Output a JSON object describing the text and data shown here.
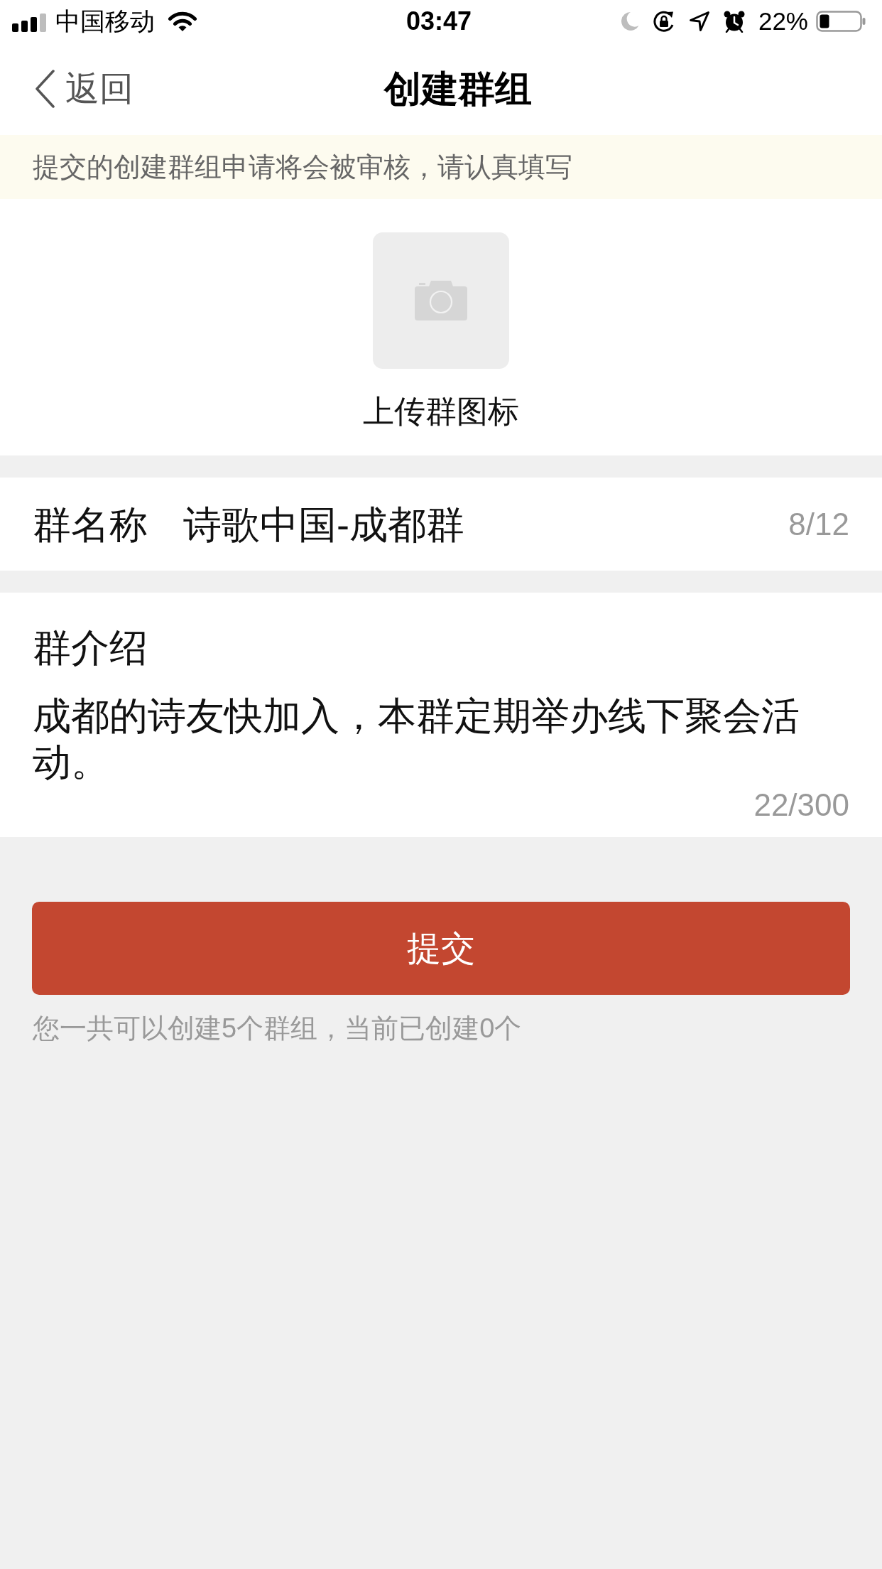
{
  "status_bar": {
    "carrier": "中国移动",
    "time": "03:47",
    "battery": "22%"
  },
  "nav_bar": {
    "back": "返回",
    "title": "创建群组"
  },
  "notice": "提交的创建群组申请将会被审核，请认真填写",
  "group_icon": {
    "label": "上传群图标"
  },
  "group_name": {
    "label": "群名称",
    "value": "诗歌中国-成都群",
    "counter": "8/12"
  },
  "group_intro": {
    "label": "群介绍",
    "value": "成都的诗友快加入，本群定期举办线下聚会活动。",
    "counter": "22/300"
  },
  "submit_button": {
    "label": "提交"
  },
  "quota_hint": "您一共可以创建5个群组，当前已创建0个"
}
